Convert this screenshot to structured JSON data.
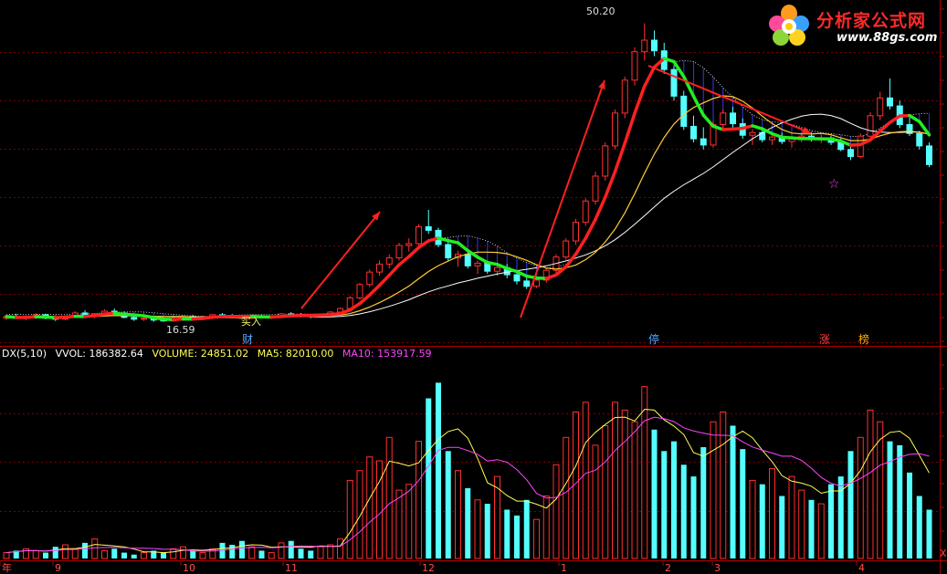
{
  "logo": {
    "text": "分析家公式网",
    "url": "www.88gs.com"
  },
  "price_panel": {
    "high_label": "50.20",
    "low_label": "16.59",
    "buy_label": "买入",
    "markers": [
      {
        "text": "财",
        "color": "#4fa8ff"
      },
      {
        "text": "停",
        "color": "#4fa8ff"
      },
      {
        "text": "涨",
        "color": "#ff4040"
      },
      {
        "text": "榜",
        "color": "#ffaa00"
      }
    ]
  },
  "indicator": {
    "name": "DX(5,10)",
    "vol_label": "VVOL: 186382.64",
    "volume_label": "VOLUME: 24851.02",
    "ma5_label": "MA5: 82010.00",
    "ma10_label": "MA10: 153917.59",
    "colors": {
      "name": "#ffffff",
      "vol": "#ffffff",
      "volume": "#ffff55",
      "ma5": "#ffff55",
      "ma10": "#ff44ff"
    }
  },
  "x_axis": {
    "labels": [
      "年",
      "9",
      "10",
      "11",
      "12",
      "1",
      "2",
      "3",
      "4"
    ],
    "corner": "X"
  },
  "chart_data": [
    {
      "type": "candlestick",
      "ylim": [
        14,
        52
      ],
      "up_color": "#ff3030",
      "down_color": "#54ffff",
      "candles": [
        [
          17.0,
          17.4,
          16.8,
          17.2
        ],
        [
          17.2,
          17.5,
          16.9,
          17.0
        ],
        [
          17.0,
          17.3,
          16.8,
          17.1
        ],
        [
          17.1,
          17.6,
          16.9,
          17.4
        ],
        [
          17.4,
          17.5,
          16.9,
          17.0
        ],
        [
          17.0,
          17.2,
          16.7,
          16.9
        ],
        [
          16.9,
          17.3,
          16.8,
          17.2
        ],
        [
          17.2,
          17.8,
          17.0,
          17.6
        ],
        [
          17.6,
          17.9,
          17.2,
          17.3
        ],
        [
          17.3,
          17.6,
          17.0,
          17.5
        ],
        [
          17.5,
          18.0,
          17.3,
          17.8
        ],
        [
          17.8,
          18.1,
          17.4,
          17.6
        ],
        [
          17.6,
          17.8,
          17.0,
          17.1
        ],
        [
          17.1,
          17.3,
          16.7,
          16.9
        ],
        [
          16.9,
          17.2,
          16.7,
          17.0
        ],
        [
          17.0,
          17.1,
          16.6,
          16.8
        ],
        [
          16.8,
          17.0,
          16.6,
          16.7
        ],
        [
          16.7,
          17.0,
          16.6,
          16.9
        ],
        [
          16.9,
          17.3,
          16.8,
          17.2
        ],
        [
          17.2,
          17.4,
          16.9,
          17.0
        ],
        [
          17.0,
          17.3,
          16.9,
          17.1
        ],
        [
          17.1,
          17.5,
          17.0,
          17.4
        ],
        [
          17.4,
          17.6,
          17.1,
          17.3
        ],
        [
          17.3,
          17.5,
          17.0,
          17.2
        ],
        [
          17.2,
          17.4,
          16.9,
          17.0
        ],
        [
          17.0,
          17.3,
          16.9,
          17.2
        ],
        [
          17.2,
          17.4,
          17.0,
          17.1
        ],
        [
          17.1,
          17.3,
          16.9,
          17.2
        ],
        [
          17.2,
          17.6,
          17.1,
          17.5
        ],
        [
          17.5,
          17.7,
          17.2,
          17.4
        ],
        [
          17.4,
          17.6,
          17.1,
          17.3
        ],
        [
          17.3,
          17.5,
          17.0,
          17.2
        ],
        [
          17.2,
          17.5,
          17.1,
          17.4
        ],
        [
          17.4,
          17.8,
          17.3,
          17.7
        ],
        [
          17.7,
          18.2,
          17.6,
          18.1
        ],
        [
          18.1,
          19.5,
          18.0,
          19.3
        ],
        [
          19.3,
          21.0,
          19.1,
          20.8
        ],
        [
          20.8,
          22.5,
          20.5,
          22.2
        ],
        [
          22.2,
          23.5,
          21.8,
          23.1
        ],
        [
          23.1,
          24.2,
          22.6,
          23.8
        ],
        [
          23.8,
          25.5,
          23.5,
          25.2
        ],
        [
          25.2,
          26.0,
          24.5,
          25.4
        ],
        [
          25.4,
          27.6,
          25.0,
          27.3
        ],
        [
          27.3,
          29.2,
          26.5,
          26.9
        ],
        [
          26.9,
          27.2,
          25.0,
          25.3
        ],
        [
          25.3,
          25.6,
          23.5,
          23.8
        ],
        [
          23.8,
          24.6,
          22.8,
          24.2
        ],
        [
          24.2,
          24.5,
          22.6,
          22.9
        ],
        [
          22.9,
          23.5,
          22.0,
          23.2
        ],
        [
          23.2,
          23.4,
          22.0,
          22.3
        ],
        [
          22.3,
          23.0,
          21.8,
          22.7
        ],
        [
          22.7,
          23.1,
          21.5,
          21.9
        ],
        [
          21.9,
          22.4,
          20.8,
          21.2
        ],
        [
          21.2,
          21.8,
          20.3,
          20.6
        ],
        [
          20.6,
          21.5,
          20.4,
          21.3
        ],
        [
          21.3,
          22.6,
          21.0,
          22.4
        ],
        [
          22.4,
          24.2,
          22.1,
          23.9
        ],
        [
          23.9,
          26.0,
          23.6,
          25.7
        ],
        [
          25.7,
          28.2,
          25.3,
          27.8
        ],
        [
          27.8,
          30.5,
          27.4,
          30.2
        ],
        [
          30.2,
          33.5,
          29.8,
          33.0
        ],
        [
          33.0,
          36.8,
          32.5,
          36.4
        ],
        [
          36.4,
          40.5,
          36.0,
          40.1
        ],
        [
          40.1,
          44.2,
          39.5,
          43.8
        ],
        [
          43.8,
          47.5,
          43.2,
          47.0
        ],
        [
          47.0,
          50.2,
          46.0,
          48.3
        ],
        [
          48.3,
          49.4,
          46.5,
          47.1
        ],
        [
          47.1,
          48.0,
          44.5,
          45.0
        ],
        [
          45.0,
          45.5,
          41.5,
          42.0
        ],
        [
          42.0,
          42.6,
          38.2,
          38.6
        ],
        [
          38.6,
          39.8,
          36.8,
          37.2
        ],
        [
          37.2,
          38.5,
          36.0,
          36.5
        ],
        [
          36.5,
          39.2,
          36.2,
          38.8
        ],
        [
          38.8,
          40.5,
          38.3,
          40.1
        ],
        [
          40.1,
          40.8,
          38.5,
          38.9
        ],
        [
          38.9,
          39.5,
          37.2,
          37.6
        ],
        [
          37.6,
          38.3,
          36.5,
          37.9
        ],
        [
          37.9,
          38.2,
          36.8,
          37.1
        ],
        [
          37.1,
          37.8,
          36.5,
          37.4
        ],
        [
          37.4,
          37.9,
          36.6,
          36.9
        ],
        [
          36.9,
          37.5,
          36.2,
          37.2
        ],
        [
          37.2,
          37.8,
          36.8,
          37.5
        ],
        [
          37.5,
          37.9,
          36.9,
          37.1
        ],
        [
          37.1,
          37.6,
          36.7,
          37.3
        ],
        [
          37.3,
          37.5,
          36.5,
          36.8
        ],
        [
          36.8,
          37.2,
          35.8,
          36.0
        ],
        [
          36.0,
          36.4,
          34.8,
          35.2
        ],
        [
          35.2,
          37.8,
          35.0,
          37.5
        ],
        [
          37.5,
          40.2,
          37.2,
          39.8
        ],
        [
          39.8,
          42.5,
          39.3,
          41.8
        ],
        [
          41.8,
          44.0,
          40.5,
          40.9
        ],
        [
          40.9,
          41.5,
          38.4,
          38.8
        ],
        [
          38.8,
          39.6,
          37.5,
          37.8
        ],
        [
          37.8,
          38.1,
          36.0,
          36.4
        ],
        [
          36.4,
          36.8,
          34.0,
          34.3
        ]
      ]
    },
    {
      "type": "bar",
      "series": [
        {
          "name": "VOLUME",
          "values": [
            3,
            4,
            5,
            4,
            3,
            6,
            7,
            5,
            8,
            10,
            4,
            5,
            3,
            2,
            3,
            4,
            3,
            5,
            6,
            4,
            3,
            5,
            8,
            7,
            9,
            6,
            4,
            3,
            8,
            9,
            5,
            4,
            6,
            7,
            10,
            40,
            45,
            52,
            50,
            62,
            35,
            38,
            60,
            82,
            90,
            55,
            45,
            36,
            30,
            28,
            42,
            25,
            22,
            30,
            20,
            32,
            48,
            62,
            75,
            80,
            58,
            68,
            80,
            76,
            70,
            88,
            66,
            55,
            60,
            48,
            42,
            57,
            70,
            75,
            68,
            56,
            40,
            38,
            46,
            32,
            42,
            35,
            30,
            28,
            38,
            42,
            55,
            62,
            76,
            70,
            60,
            58,
            44,
            32,
            25
          ]
        }
      ],
      "lines": [
        {
          "name": "MA5"
        },
        {
          "name": "MA10"
        }
      ]
    }
  ]
}
